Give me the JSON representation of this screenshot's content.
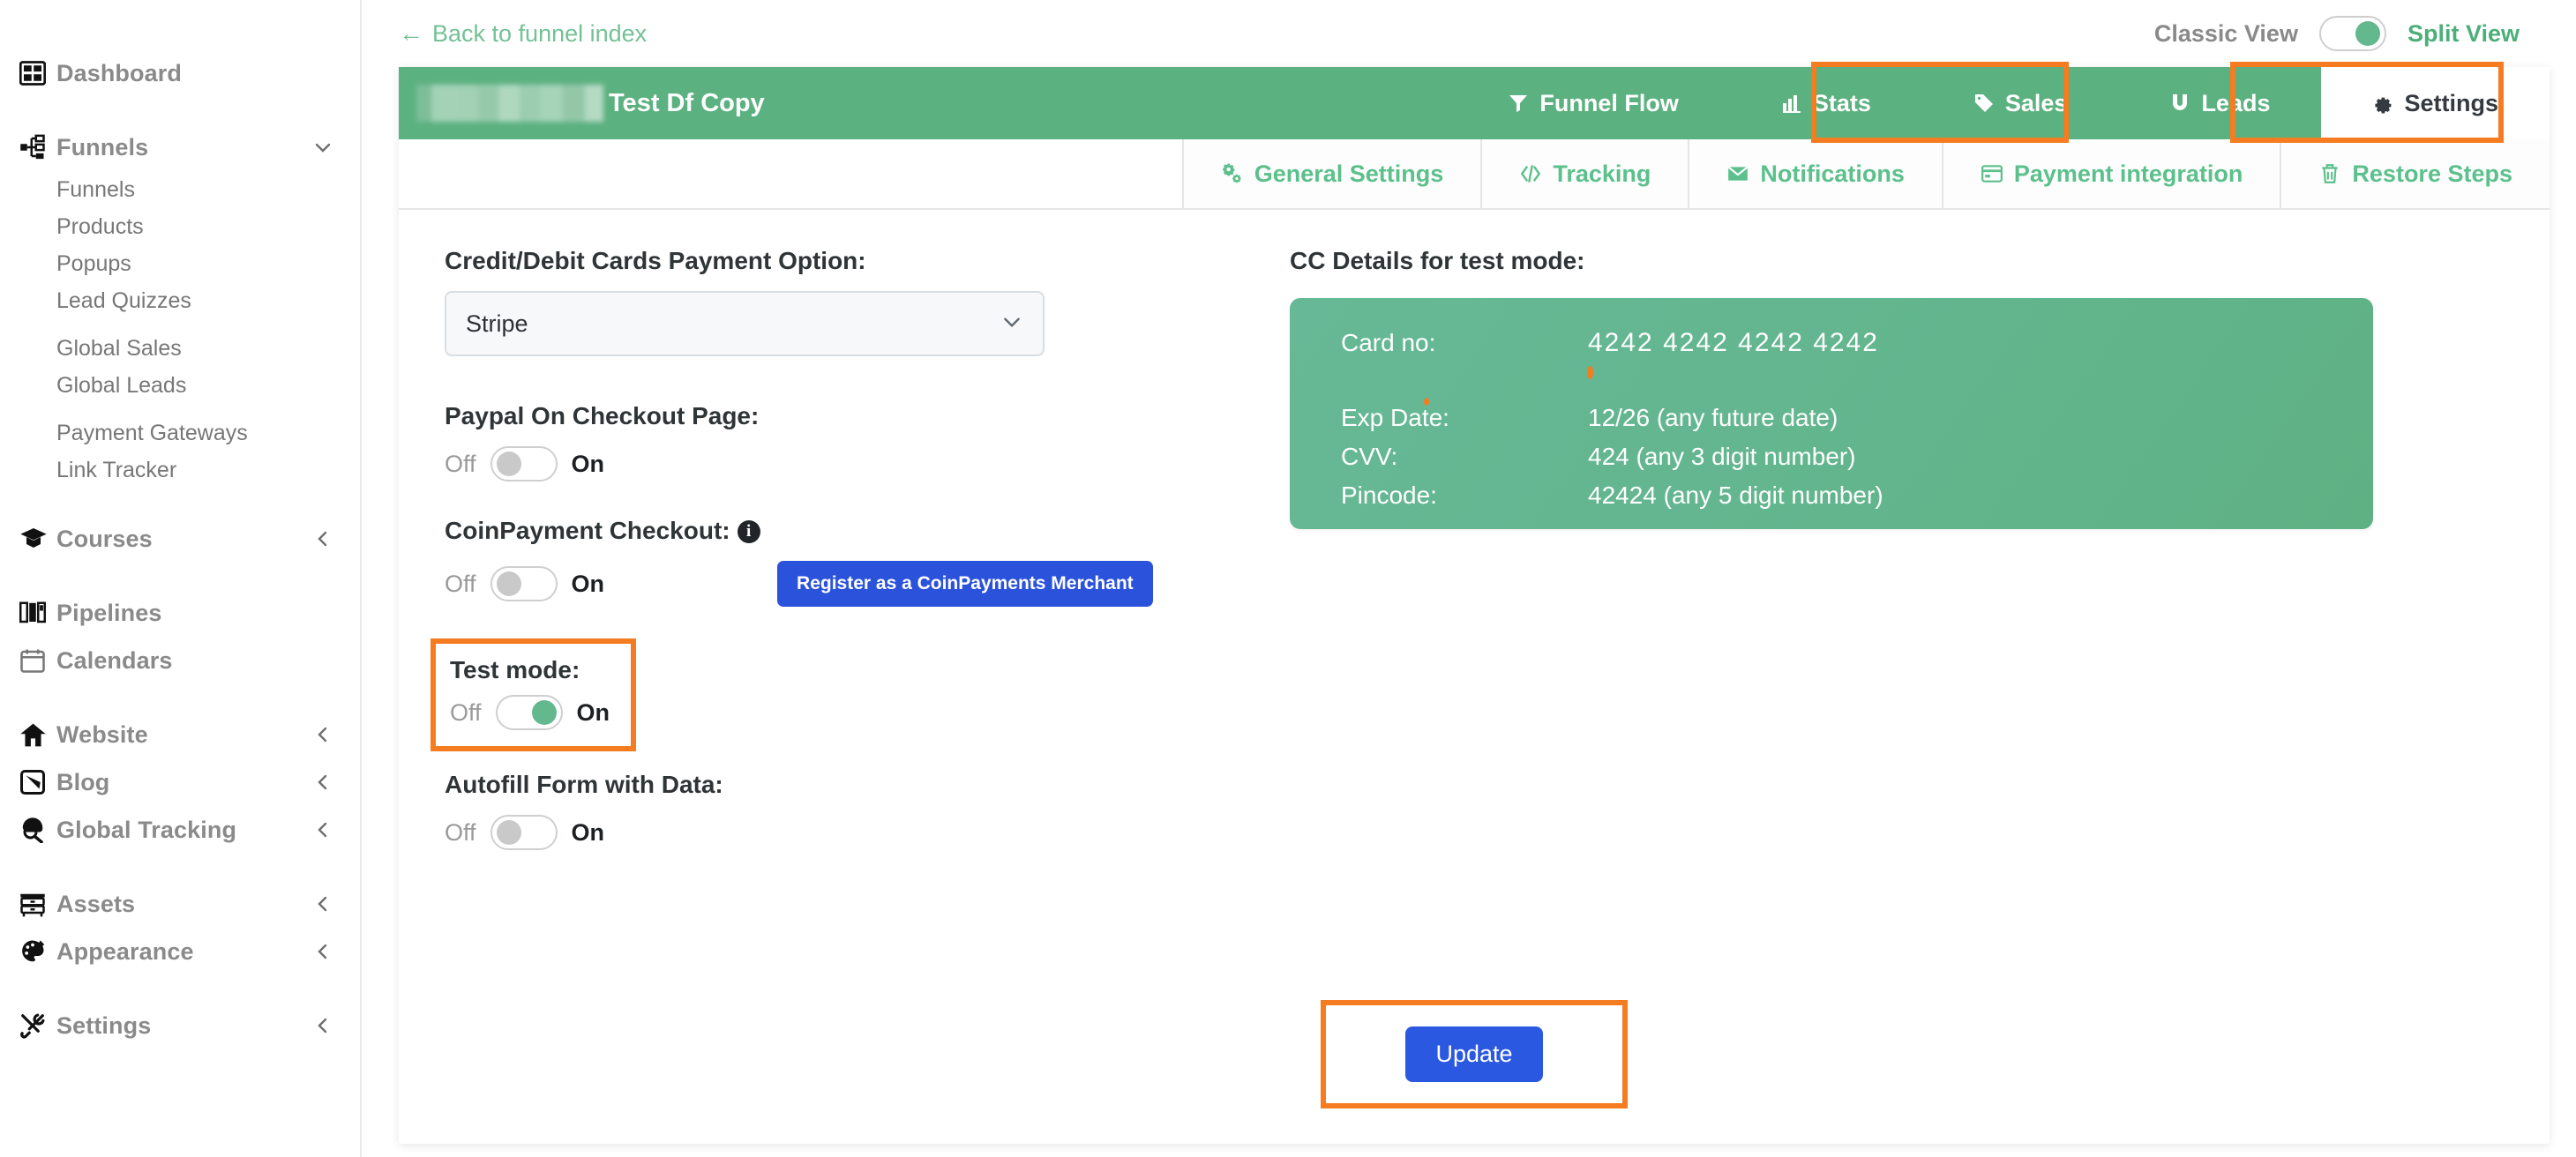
{
  "sidebar": {
    "items": [
      {
        "label": "Dashboard",
        "icon": "dashboard-icon",
        "caret": ""
      },
      {
        "label": "Funnels",
        "icon": "funnel-tree-icon",
        "caret": "down"
      },
      {
        "label": "Courses",
        "icon": "graduation-cap-icon",
        "caret": "left"
      },
      {
        "label": "Pipelines",
        "icon": "pipelines-icon",
        "caret": ""
      },
      {
        "label": "Calendars",
        "icon": "calendar-icon",
        "caret": ""
      },
      {
        "label": "Website",
        "icon": "home-icon",
        "caret": "left"
      },
      {
        "label": "Blog",
        "icon": "blog-pen-icon",
        "caret": "left"
      },
      {
        "label": "Global Tracking",
        "icon": "tracking-search-icon",
        "caret": "left"
      },
      {
        "label": "Assets",
        "icon": "assets-drawer-icon",
        "caret": "left"
      },
      {
        "label": "Appearance",
        "icon": "palette-brush-icon",
        "caret": "left"
      },
      {
        "label": "Settings",
        "icon": "tools-icon",
        "caret": "left"
      }
    ],
    "funnels_sub": [
      "Funnels",
      "Products",
      "Popups",
      "Lead Quizzes",
      "Global Sales",
      "Global Leads",
      "Payment Gateways",
      "Link Tracker"
    ]
  },
  "topbar": {
    "back_label": "Back to funnel index",
    "back_icon": "arrow-left-icon",
    "classic_view_label": "Classic View",
    "split_view_label": "Split View",
    "view_toggle_state": "on"
  },
  "funnel_bar": {
    "logo": "redacted-logo",
    "funnel_name": "Test Df Copy",
    "tabs": [
      {
        "label": "Funnel Flow",
        "icon": "funnel-filter-icon",
        "active": false
      },
      {
        "label": "Stats",
        "icon": "bar-chart-icon",
        "active": false
      },
      {
        "label": "Sales",
        "icon": "tag-icon",
        "active": false
      },
      {
        "label": "Leads",
        "icon": "magnet-icon",
        "active": false
      },
      {
        "label": "Settings",
        "icon": "gear-icon",
        "active": true
      }
    ]
  },
  "subtabs": [
    {
      "label": "General Settings",
      "icon": "gears-icon"
    },
    {
      "label": "Tracking",
      "icon": "code-icon"
    },
    {
      "label": "Notifications",
      "icon": "envelope-icon"
    },
    {
      "label": "Payment integration",
      "icon": "credit-card-icon",
      "highlighted": true
    },
    {
      "label": "Restore Steps",
      "icon": "trash-icon"
    }
  ],
  "form": {
    "payment_option_label": "Credit/Debit Cards Payment Option:",
    "payment_option_value": "Stripe",
    "payment_option_choices": [
      "Stripe"
    ],
    "paypal_label": "Paypal On Checkout Page:",
    "paypal_state": "off",
    "coinpayment_label": "CoinPayment Checkout:",
    "coinpayment_state": "off",
    "coinpayment_info_icon": "info-icon",
    "coinpayment_button": "Register as a CoinPayments Merchant",
    "testmode_label": "Test mode:",
    "testmode_state": "on",
    "autofill_label": "Autofill Form with Data:",
    "autofill_state": "off",
    "off_label": "Off",
    "on_label": "On",
    "update_button": "Update"
  },
  "cc_details": {
    "title": "CC Details for test mode:",
    "rows": [
      {
        "key": "Card no:",
        "value": "4242  4242  4242  4242"
      },
      {
        "key": "Exp Date:",
        "value": "12/26 (any future date)"
      },
      {
        "key": "CVV:",
        "value": "424 (any 3 digit number)"
      },
      {
        "key": "Pincode:",
        "value": "42424 (any 5 digit number)"
      }
    ]
  },
  "colors": {
    "brand_green": "#5cb180",
    "card_green": "#63b68f",
    "accent_green": "#5cc08c",
    "highlight_orange": "#f57c20",
    "primary_blue": "#2b58e0",
    "coin_blue": "#2b52db"
  }
}
